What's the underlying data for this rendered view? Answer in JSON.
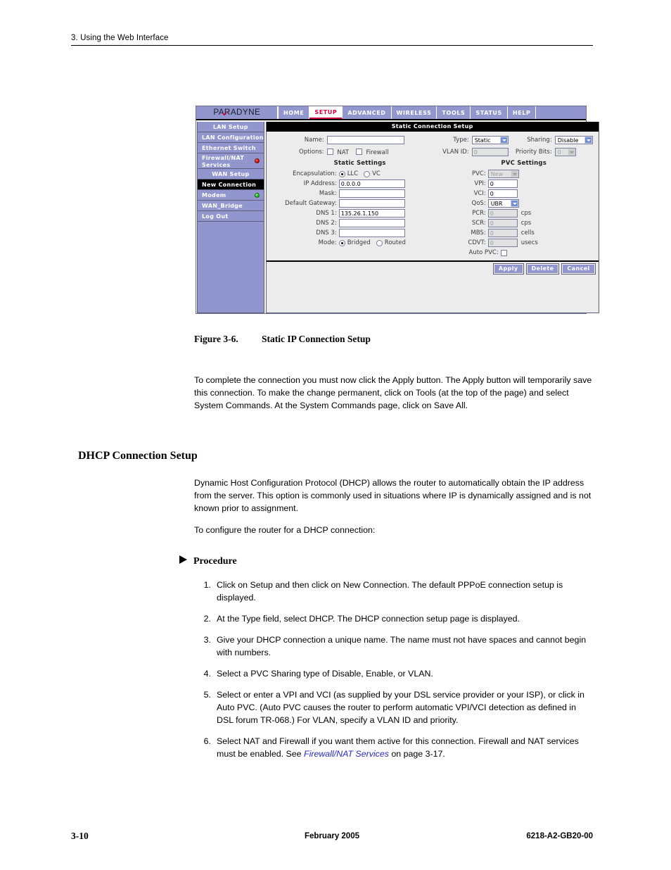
{
  "page": {
    "running_header": "3. Using the Web Interface",
    "footer_page_number": "3-10",
    "footer_date": "February 2005",
    "footer_docnum": "6218-A2-GB20-00"
  },
  "figure": {
    "number": "Figure 3-6.",
    "title": "Static IP Connection Setup"
  },
  "router_ui": {
    "brand": "PARADYNE",
    "brand_tm": "®",
    "nav": [
      {
        "label": "HOME",
        "active": false
      },
      {
        "label": "SETUP",
        "active": true
      },
      {
        "label": "ADVANCED",
        "active": false
      },
      {
        "label": "WIRELESS",
        "active": false
      },
      {
        "label": "TOOLS",
        "active": false
      },
      {
        "label": "STATUS",
        "active": false
      },
      {
        "label": "HELP",
        "active": false
      }
    ],
    "sidebar": [
      {
        "label": "LAN Setup",
        "selected": false,
        "center": true,
        "led": null
      },
      {
        "label": "LAN Configuration",
        "selected": false,
        "center": false,
        "led": null
      },
      {
        "label": "Ethernet Switch",
        "selected": false,
        "center": false,
        "led": null
      },
      {
        "label": "Firewall/NAT Services",
        "selected": false,
        "center": false,
        "led": "red"
      },
      {
        "label": "WAN Setup",
        "selected": false,
        "center": true,
        "led": null
      },
      {
        "label": "New Connection",
        "selected": true,
        "center": false,
        "led": null
      },
      {
        "label": "Modem",
        "selected": false,
        "center": false,
        "led": "green"
      },
      {
        "label": "WAN_Bridge",
        "selected": false,
        "center": false,
        "led": null
      },
      {
        "label": "Log Out",
        "selected": false,
        "center": false,
        "led": null
      }
    ],
    "panel_title": "Static Connection Setup",
    "top_form": {
      "name_label": "Name:",
      "name_value": "",
      "options_label": "Options:",
      "nat_label": "NAT",
      "firewall_label": "Firewall",
      "type_label": "Type:",
      "type_value": "Static",
      "vlan_id_label": "VLAN ID:",
      "vlan_id_value": "0",
      "sharing_label": "Sharing:",
      "sharing_value": "Disable",
      "priority_bits_label": "Priority Bits:",
      "priority_bits_value": "0"
    },
    "static_settings": {
      "section_title": "Static Settings",
      "encapsulation_label": "Encapsulation:",
      "encap_llc": "LLC",
      "encap_vc": "VC",
      "encap_selected": "LLC",
      "ip_address_label": "IP Address:",
      "ip_address_value": "0.0.0.0",
      "mask_label": "Mask:",
      "mask_value": "",
      "default_gateway_label": "Default Gateway:",
      "default_gateway_value": "",
      "dns1_label": "DNS 1:",
      "dns1_value": "135.26.1.150",
      "dns2_label": "DNS 2:",
      "dns2_value": "",
      "dns3_label": "DNS 3:",
      "dns3_value": "",
      "mode_label": "Mode:",
      "mode_bridged": "Bridged",
      "mode_routed": "Routed",
      "mode_selected": "Bridged"
    },
    "pvc_settings": {
      "section_title": "PVC Settings",
      "pvc_label": "PVC:",
      "pvc_value": "New",
      "vpi_label": "VPI:",
      "vpi_value": "0",
      "vci_label": "VCI:",
      "vci_value": "0",
      "qos_label": "QoS:",
      "qos_value": "UBR",
      "pcr_label": "PCR:",
      "pcr_value": "0",
      "pcr_units": "cps",
      "scr_label": "SCR:",
      "scr_value": "0",
      "scr_units": "cps",
      "mbs_label": "MBS:",
      "mbs_value": "0",
      "mbs_units": "cells",
      "cdvt_label": "CDVT:",
      "cdvt_value": "0",
      "cdvt_units": "usecs",
      "auto_pvc_label": "Auto PVC:"
    },
    "buttons": {
      "apply": "Apply",
      "delete": "Delete",
      "cancel": "Cancel"
    },
    "colors": {
      "brand_purple": "#9196ce",
      "active_tab_text": "#d2003c",
      "panel_bg": "#ececec",
      "led_red": "#cc0000",
      "led_green": "#18a818"
    }
  },
  "content": {
    "apply_paragraph": "To complete the connection you must now click the Apply button. The Apply button will temporarily save this connection. To make the change permanent, click on Tools (at the top of the page) and select System Commands. At the System Commands page, click on Save All.",
    "section_heading": "DHCP Connection Setup",
    "dhcp_paragraph_1": "Dynamic Host Configuration Protocol (DHCP) allows the router to automatically obtain the IP address from the server. This option is commonly used in situations where IP is dynamically assigned and is not known prior to assignment.",
    "dhcp_paragraph_2": "To configure the router for a DHCP connection:",
    "procedure_heading": "Procedure",
    "steps": [
      {
        "num": "1.",
        "text": "Click on Setup and then click on New Connection. The default PPPoE connection setup is displayed."
      },
      {
        "num": "2.",
        "text": "At the Type field, select DHCP. The DHCP connection setup page is displayed."
      },
      {
        "num": "3.",
        "text": "Give your DHCP connection a unique name. The name must not have spaces and cannot begin with numbers."
      },
      {
        "num": "4.",
        "text": "Select a PVC Sharing type of Disable, Enable, or VLAN."
      },
      {
        "num": "5.",
        "text": "Select or enter a VPI and VCI (as supplied by your DSL service provider or your ISP), or click in Auto PVC. (Auto PVC causes the router to perform automatic VPI/VCI detection as defined in DSL forum TR-068.) For VLAN, specify a VLAN ID and priority."
      },
      {
        "num": "6.",
        "text_before": "Select NAT and Firewall if you want them active for this connection. Firewall and NAT services must be enabled. See ",
        "xref": "Firewall/NAT Services",
        "text_after": " on page 3-17."
      }
    ]
  }
}
